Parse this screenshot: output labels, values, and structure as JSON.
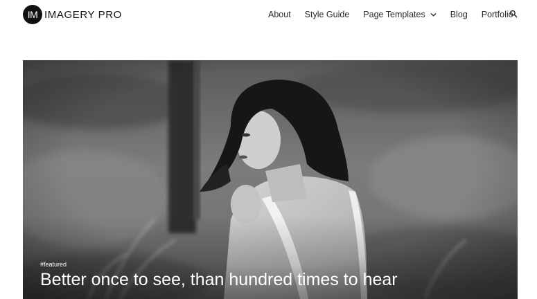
{
  "site": {
    "logo_mark": "IM",
    "logo_text": "IMAGERY PRO"
  },
  "nav": {
    "items": [
      {
        "label": "About"
      },
      {
        "label": "Style Guide"
      },
      {
        "label": "Page Templates",
        "has_dropdown": true
      },
      {
        "label": "Blog"
      },
      {
        "label": "Portfolio"
      }
    ],
    "search_icon": "search-icon"
  },
  "hero": {
    "tag": "#featured",
    "title": "Better once to see, than hundred times to hear",
    "image": "black-and-white photo of a woman with dark hair looking over her shoulder in a field"
  },
  "colors": {
    "text": "#2a2a2a",
    "logo": "#111111",
    "hero_text": "#ffffff"
  }
}
